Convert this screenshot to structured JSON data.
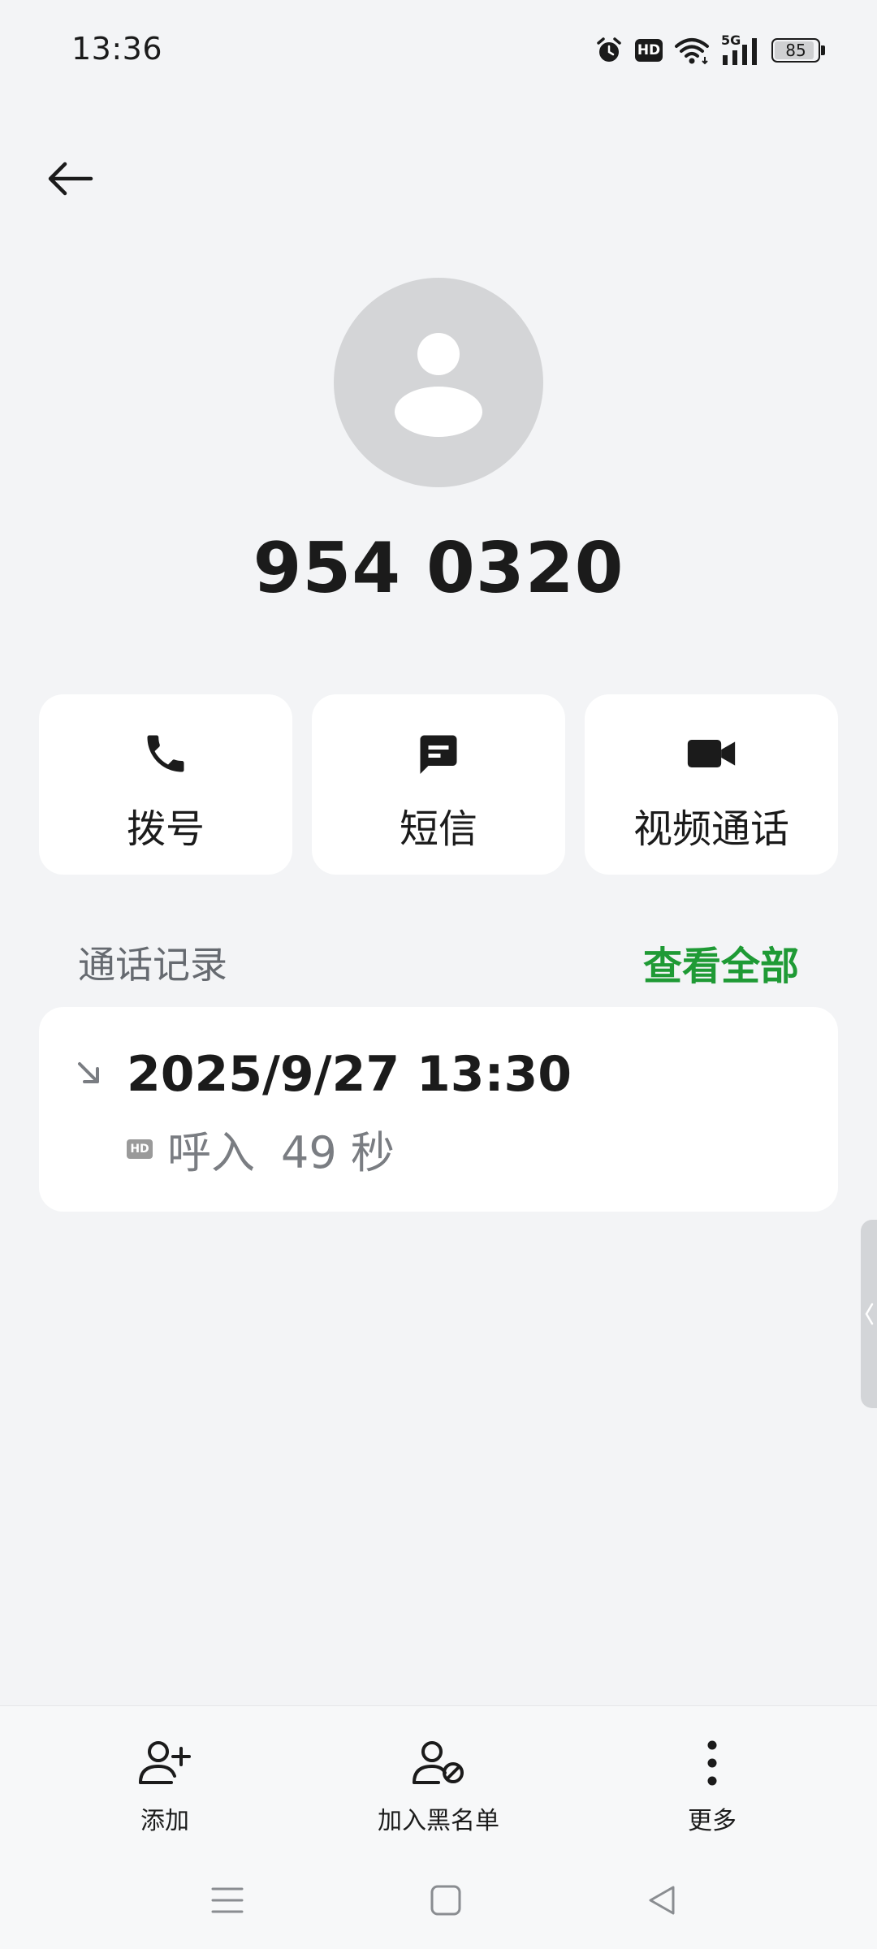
{
  "status_bar": {
    "time": "13:36",
    "hd_label": "HD",
    "network_label": "5G",
    "battery": "85",
    "icons": [
      "alarm-icon",
      "hd-icon",
      "wifi-icon",
      "signal-icon",
      "battery-icon"
    ]
  },
  "contact": {
    "name": "954 0320"
  },
  "actions": [
    {
      "label": "拨号",
      "icon": "phone-icon"
    },
    {
      "label": "短信",
      "icon": "message-icon"
    },
    {
      "label": "视频通话",
      "icon": "video-icon"
    }
  ],
  "call_log": {
    "title": "通话记录",
    "view_all": "查看全部",
    "entries": [
      {
        "time": "2025/9/27 13:30",
        "hd": "HD",
        "type": "呼入",
        "duration": "49 秒",
        "direction_icon": "incoming-call-icon"
      }
    ]
  },
  "bottom_actions": [
    {
      "label": "添加",
      "icon": "add-contact-icon"
    },
    {
      "label": "加入黑名单",
      "icon": "block-contact-icon"
    },
    {
      "label": "更多",
      "icon": "more-vertical-icon"
    }
  ],
  "colors": {
    "accent": "#1f9a35",
    "background": "#f3f4f6",
    "card": "#ffffff",
    "avatar": "#d4d5d7"
  }
}
